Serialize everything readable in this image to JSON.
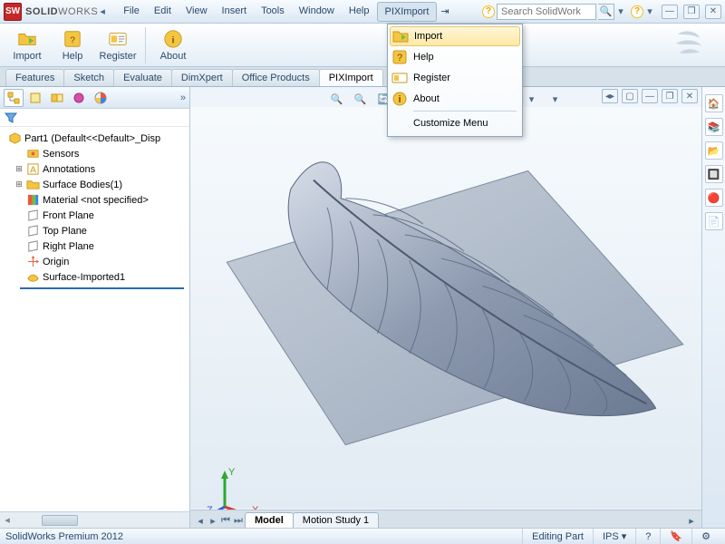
{
  "app": {
    "brand1": "SOLID",
    "brand2": "WORKS"
  },
  "menu": [
    "File",
    "Edit",
    "View",
    "Insert",
    "Tools",
    "Window",
    "Help",
    "PIXImport"
  ],
  "search": {
    "placeholder": "Search SolidWork"
  },
  "toolbar": {
    "import": "Import",
    "help": "Help",
    "register": "Register",
    "about": "About"
  },
  "cmtabs": [
    "Features",
    "Sketch",
    "Evaluate",
    "DimXpert",
    "Office Products",
    "PIXImport"
  ],
  "sidebar": {
    "root": "Part1  (Default<<Default>_Disp",
    "items": [
      {
        "label": "Sensors",
        "icon": "sensor"
      },
      {
        "label": "Annotations",
        "icon": "annot"
      },
      {
        "label": "Surface Bodies(1)",
        "icon": "folder"
      },
      {
        "label": "Material <not specified>",
        "icon": "material"
      },
      {
        "label": "Front Plane",
        "icon": "plane"
      },
      {
        "label": "Top Plane",
        "icon": "plane"
      },
      {
        "label": "Right Plane",
        "icon": "plane"
      },
      {
        "label": "Origin",
        "icon": "origin"
      },
      {
        "label": "Surface-Imported1",
        "icon": "surf"
      }
    ]
  },
  "doctabs": {
    "model": "Model",
    "motion": "Motion Study 1"
  },
  "status": {
    "product": "SolidWorks Premium 2012",
    "mode": "Editing Part",
    "units": "IPS"
  },
  "dropdown": {
    "import": "Import",
    "help": "Help",
    "register": "Register",
    "about": "About",
    "customize": "Customize Menu"
  },
  "triad": {
    "x": "X",
    "y": "Y",
    "z": "Z"
  }
}
